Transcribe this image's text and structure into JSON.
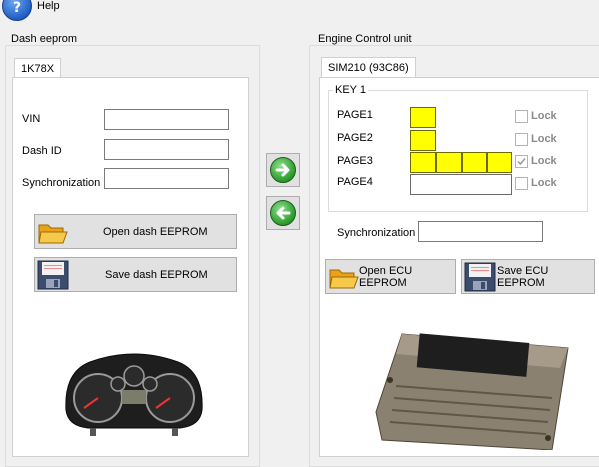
{
  "menu": {
    "help": "Help"
  },
  "dash": {
    "group_title": "Dash eeprom",
    "tab": "1K78X",
    "fields": [
      {
        "label": "VIN",
        "value": ""
      },
      {
        "label": "Dash ID",
        "value": ""
      },
      {
        "label": "Synchronization",
        "value": ""
      }
    ],
    "open_button": "Open dash EEPROM",
    "save_button": "Save dash EEPROM"
  },
  "ecu": {
    "group_title": "Engine Control unit",
    "tab": "SIM210  (93C86)",
    "key_group": "KEY 1",
    "pages": [
      {
        "label": "PAGE1",
        "cells": [
          "filled"
        ],
        "lock": "Lock",
        "locked": false
      },
      {
        "label": "PAGE2",
        "cells": [
          "filled"
        ],
        "lock": "Lock",
        "locked": false
      },
      {
        "label": "PAGE3",
        "cells": [
          "filled",
          "filled",
          "filled",
          "filled"
        ],
        "lock": "Lock",
        "locked": true
      },
      {
        "label": "PAGE4",
        "cells": [
          "empty"
        ],
        "lock": "Lock",
        "locked": false
      }
    ],
    "sync_label": "Synchronization",
    "sync_value": "",
    "open_button": "Open ECU EEPROM",
    "save_button": "Save ECU EEPROM"
  },
  "colors": {
    "page_fill": "#ffff00",
    "arrow_green": "#2f9f2f",
    "help_blue": "#1f5fc4"
  },
  "icons": {
    "help": "help-icon",
    "transfer_right": "arrow-right-icon",
    "transfer_left": "arrow-left-icon",
    "open": "folder-icon",
    "save": "floppy-disk-icon"
  }
}
